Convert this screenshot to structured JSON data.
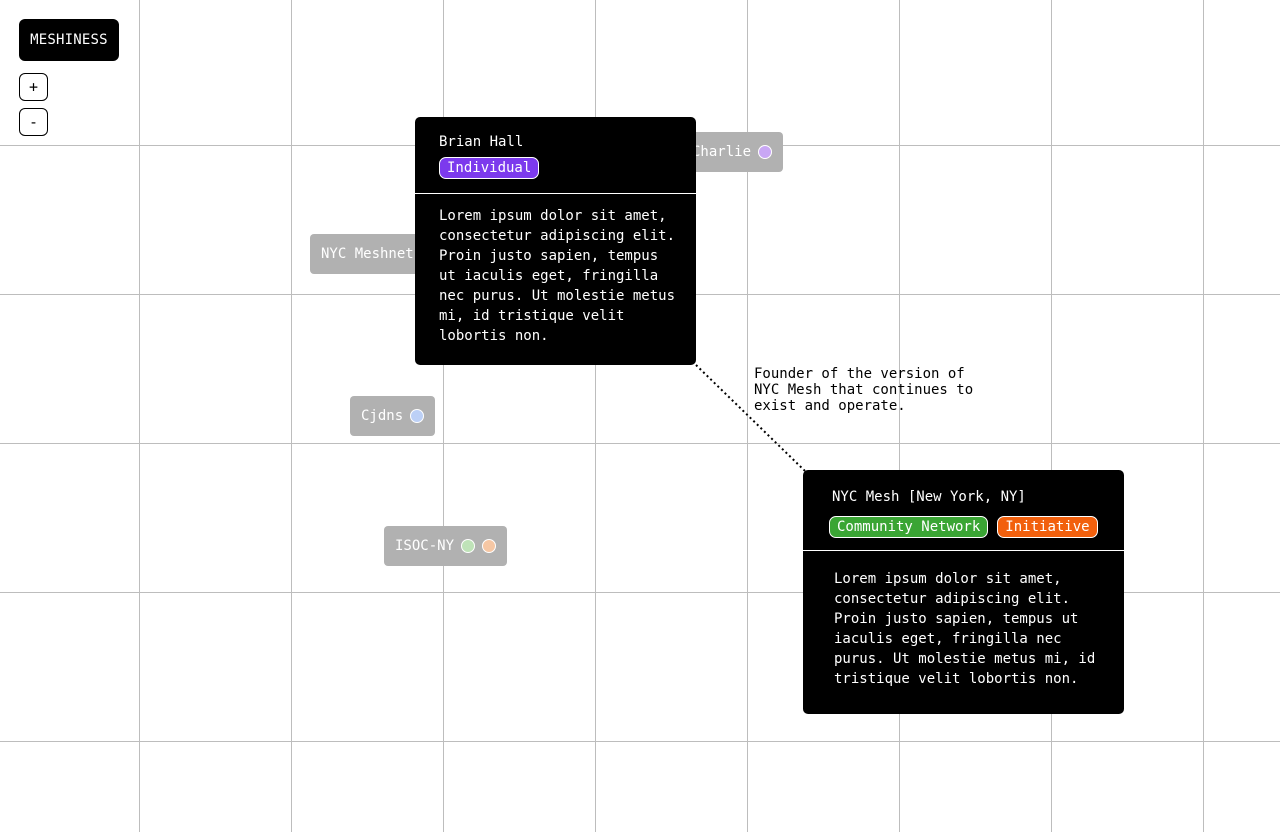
{
  "app": {
    "title": "MESHINESS"
  },
  "zoom": {
    "in_label": "+",
    "out_label": "-"
  },
  "nodes": [
    {
      "label": "NYC Meshnet",
      "dots": []
    },
    {
      "label": "Charlie",
      "dots": [
        "#c9a7f5"
      ]
    },
    {
      "label": "Cjdns",
      "dots": [
        "#bcd0f6"
      ]
    },
    {
      "label": "ISOC-NY",
      "dots": [
        "#bfe3b8",
        "#f6c7a4"
      ]
    }
  ],
  "cards": {
    "person": {
      "title": "Brian Hall",
      "tags": [
        {
          "label": "Individual",
          "color": "#7c3aed"
        }
      ],
      "description": "Lorem ipsum dolor sit amet, consectetur adipiscing elit. Proin justo sapien, tempus ut iaculis eget, fringilla nec purus. Ut molestie metus mi, id tristique velit lobortis non."
    },
    "org": {
      "title": "NYC Mesh [New York, NY]",
      "tags": [
        {
          "label": "Community Network",
          "color": "#3aa534"
        },
        {
          "label": "Initiative",
          "color": "#f2600d"
        }
      ],
      "description": "Lorem ipsum dolor sit amet, consectetur adipiscing elit. Proin justo sapien, tempus ut iaculis eget, fringilla nec purus. Ut molestie metus mi, id tristique velit lobortis non."
    }
  },
  "relation": {
    "label": "Founder of the version of NYC Mesh that continues to exist and operate."
  }
}
